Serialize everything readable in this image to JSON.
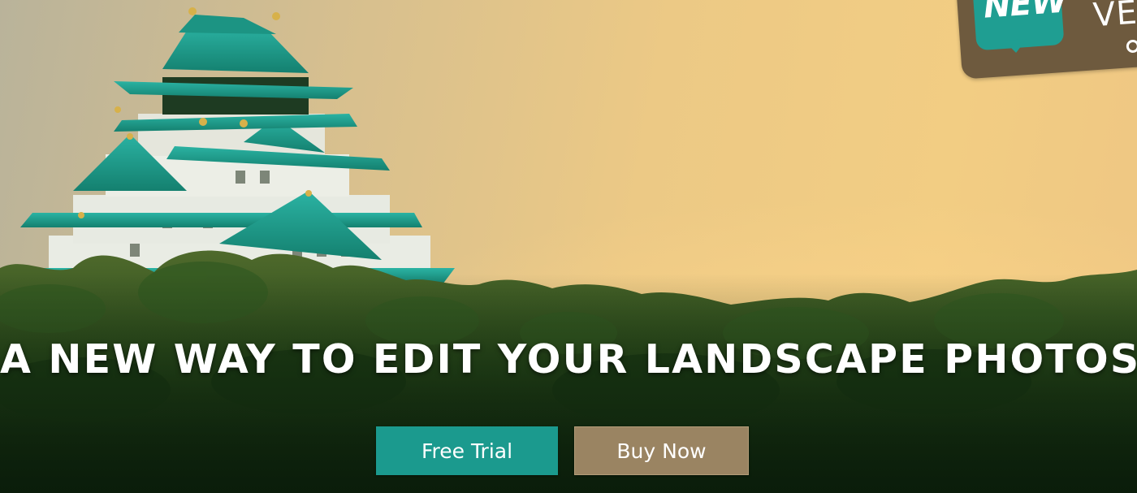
{
  "hero": {
    "headline": "A NEW WAY TO EDIT YOUR LANDSCAPE PHOTOS",
    "background_image": "japanese-castle-sunset-landscape"
  },
  "buttons": {
    "free_trial_label": "Free Trial",
    "buy_now_label": "Buy Now"
  },
  "badge": {
    "new_label": "NEW",
    "version_label": "VER",
    "icon": "speech-bubble-icon"
  },
  "colors": {
    "accent_teal": "#1b9a8e",
    "buy_brown": "#9a8462",
    "badge_brown": "#6e5a3e",
    "sky_gold": "#f2cd83",
    "forest_dark": "#0f2a10"
  }
}
